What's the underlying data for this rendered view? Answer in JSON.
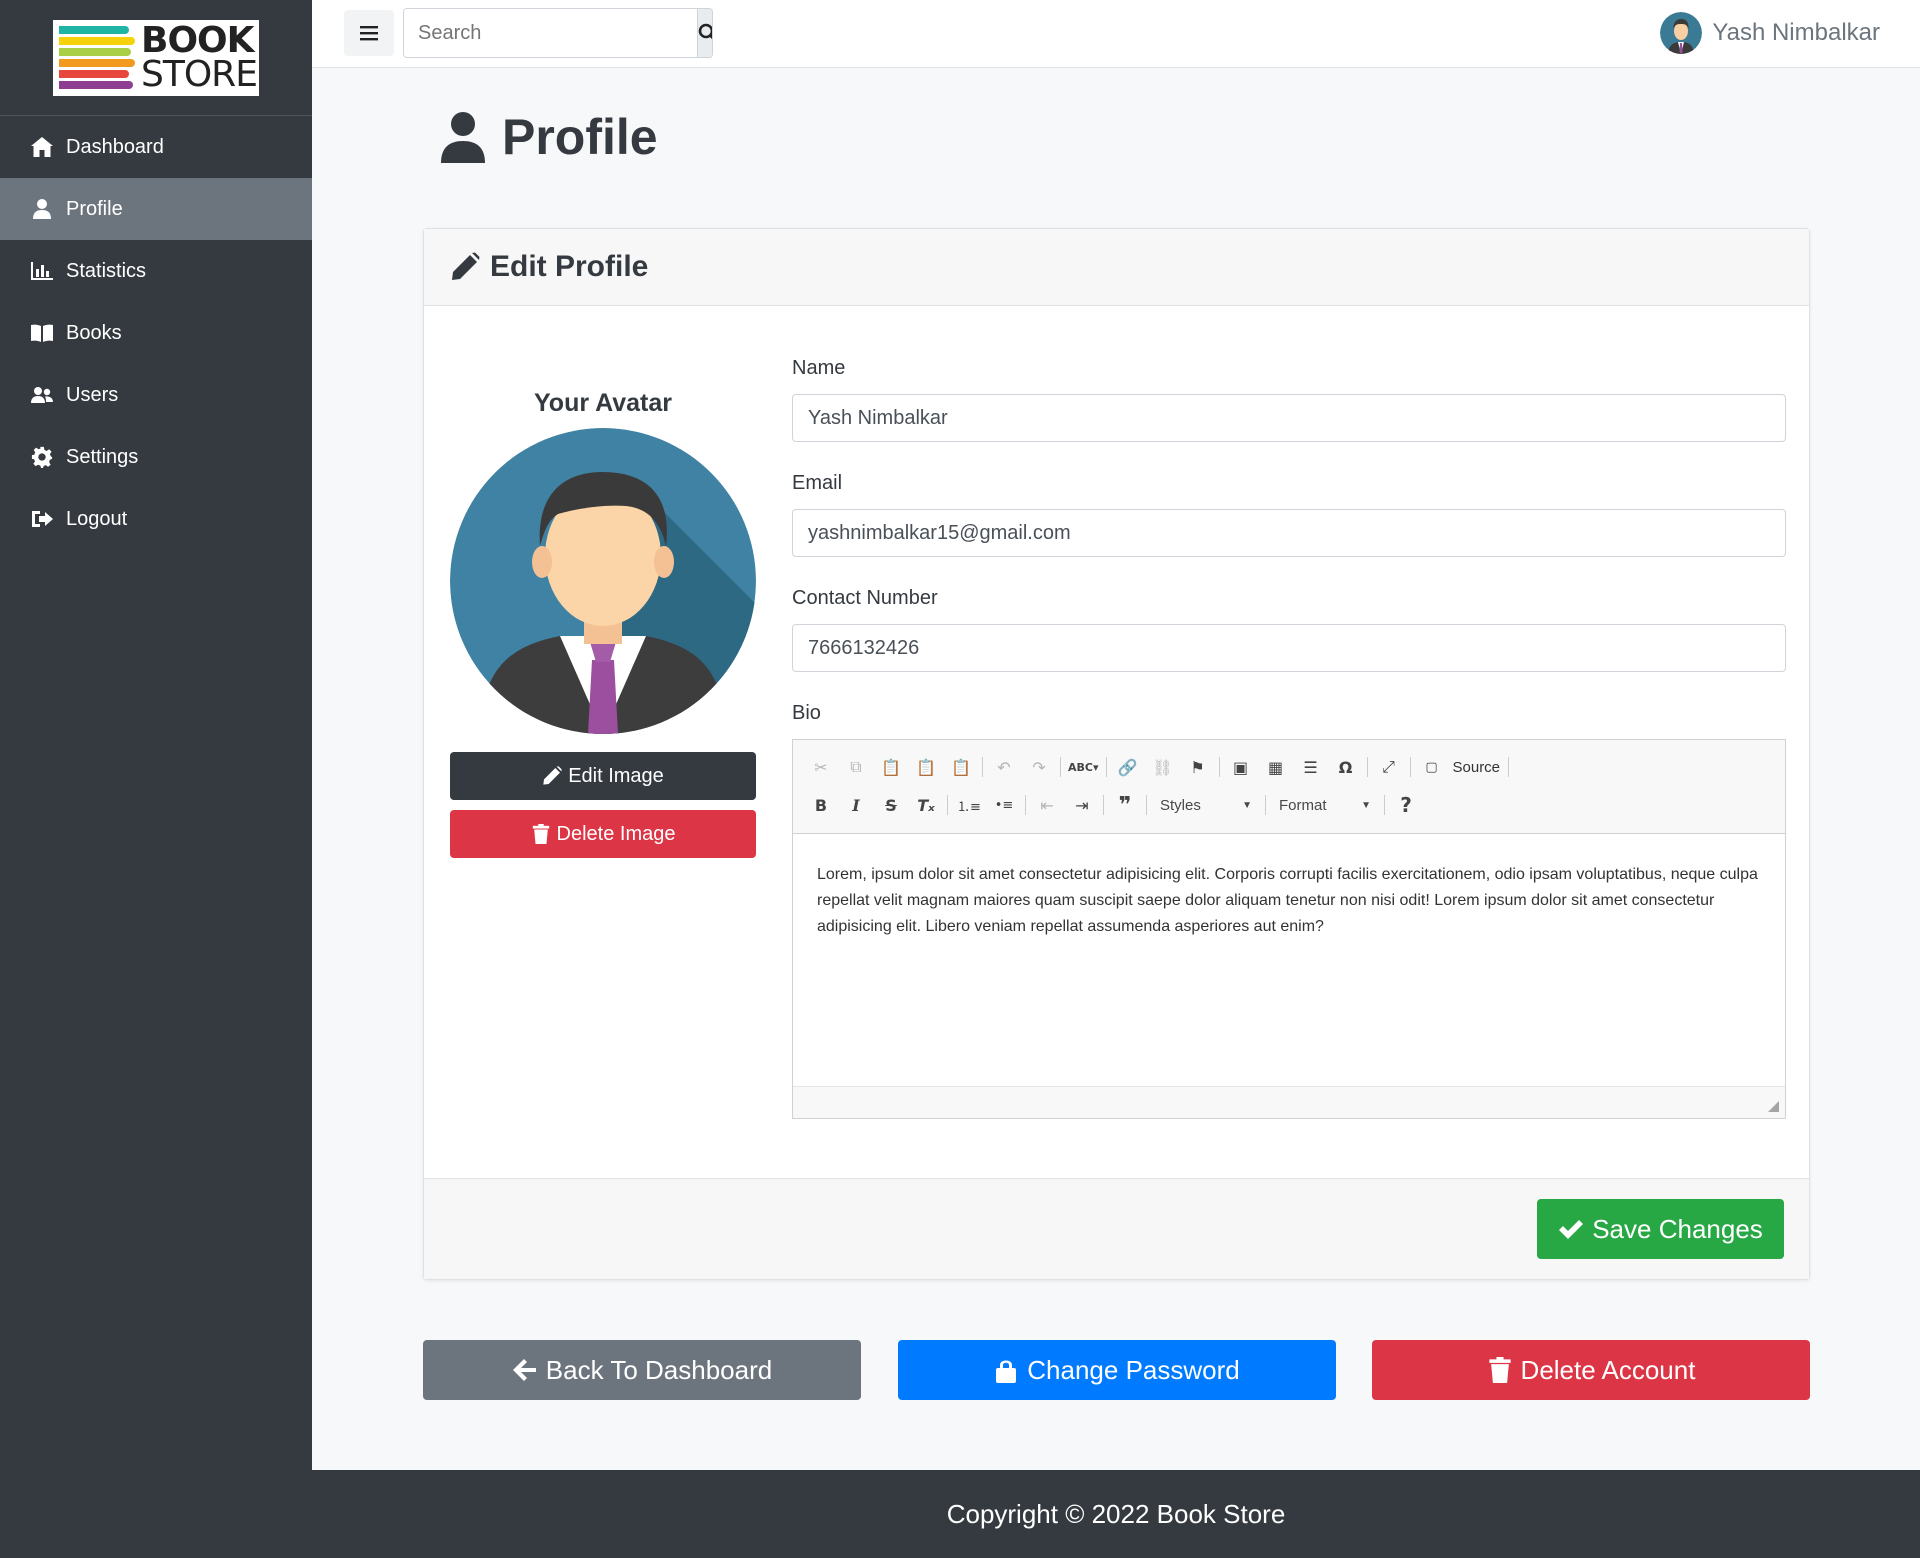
{
  "brand": {
    "logo_line1": "BOOK",
    "logo_line2": "STORE"
  },
  "sidebar": {
    "items": [
      {
        "label": "Dashboard",
        "icon": "home-icon"
      },
      {
        "label": "Profile",
        "icon": "user-icon",
        "active": true
      },
      {
        "label": "Statistics",
        "icon": "chart-bar-icon"
      },
      {
        "label": "Books",
        "icon": "book-open-icon"
      },
      {
        "label": "Users",
        "icon": "users-icon"
      },
      {
        "label": "Settings",
        "icon": "gear-icon"
      },
      {
        "label": "Logout",
        "icon": "logout-icon"
      }
    ]
  },
  "topbar": {
    "search_placeholder": "Search",
    "user_name": "Yash Nimbalkar"
  },
  "page": {
    "title": "Profile"
  },
  "card": {
    "header": "Edit Profile",
    "avatar_title": "Your Avatar",
    "edit_image": "Edit Image",
    "delete_image": "Delete Image",
    "fields": {
      "name_label": "Name",
      "name_value": "Yash Nimbalkar",
      "email_label": "Email",
      "email_value": "yashnimbalkar15@gmail.com",
      "contact_label": "Contact Number",
      "contact_value": "7666132426",
      "bio_label": "Bio"
    },
    "editor": {
      "source_label": "Source",
      "styles_label": "Styles",
      "format_label": "Format",
      "bio_text": "Lorem, ipsum dolor sit amet consectetur adipisicing elit. Corporis corrupti facilis exercitationem, odio ipsam voluptatibus, neque culpa repellat velit magnam maiores quam suscipit saepe dolor aliquam tenetur non nisi odit! Lorem ipsum dolor sit amet consectetur adipisicing elit. Libero veniam repellat assumenda asperiores aut enim?"
    },
    "save_label": "Save Changes"
  },
  "actions": {
    "back": "Back To Dashboard",
    "change_password": "Change Password",
    "delete_account": "Delete Account"
  },
  "footer": {
    "copyright": "Copyright © 2022 Book Store"
  },
  "colors": {
    "sidebar_bg": "#343a40",
    "active_item": "#6c757d",
    "primary": "#007bff",
    "danger": "#dc3545",
    "success": "#28a745",
    "secondary": "#6c757d"
  }
}
